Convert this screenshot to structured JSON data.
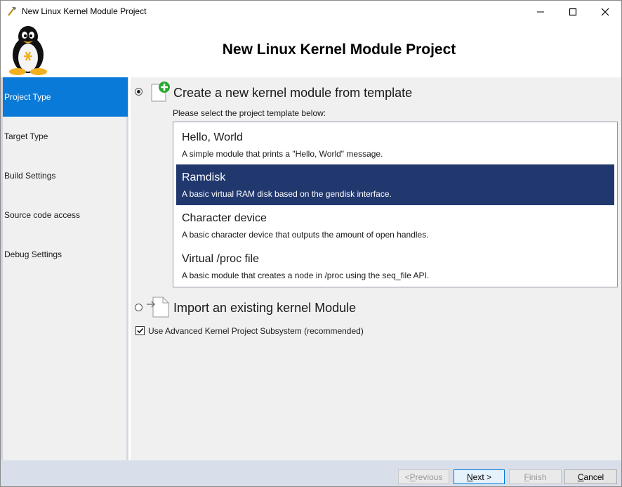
{
  "window": {
    "title": "New Linux Kernel Module Project",
    "controls": {
      "minimize_icon": "minimize-icon",
      "maximize_icon": "maximize-icon",
      "close_icon": "close-icon"
    }
  },
  "header": {
    "title": "New Linux Kernel Module Project",
    "logo_icon": "tux-penguin-icon"
  },
  "sidebar": {
    "items": [
      {
        "label": "Project Type",
        "active": true
      },
      {
        "label": "Target Type",
        "active": false
      },
      {
        "label": "Build Settings",
        "active": false
      },
      {
        "label": "Source code access",
        "active": false
      },
      {
        "label": "Debug Settings",
        "active": false
      }
    ]
  },
  "main": {
    "create_option": {
      "label": "Create a new kernel module from template",
      "selected": true,
      "icon": "new-document-icon"
    },
    "template_prompt": "Please select the project template below:",
    "templates": [
      {
        "title": "Hello, World",
        "desc": "A simple module that prints a \"Hello, World\" message.",
        "selected": false
      },
      {
        "title": "Ramdisk",
        "desc": "A basic virtual RAM disk based on the gendisk interface.",
        "selected": true
      },
      {
        "title": "Character device",
        "desc": "A basic character device that outputs the amount of open handles.",
        "selected": false
      },
      {
        "title": "Virtual /proc file",
        "desc": "A basic module that creates a node in /proc using the seq_file API.",
        "selected": false
      }
    ],
    "import_option": {
      "label": "Import an existing kernel Module",
      "selected": false,
      "icon": "import-document-icon"
    },
    "advanced_checkbox": {
      "label": "Use Advanced Kernel Project Subsystem (recommended)",
      "checked": true
    }
  },
  "footer": {
    "previous": {
      "prefix": "< ",
      "hotkey": "P",
      "rest": "revious"
    },
    "next": {
      "hotkey": "N",
      "rest": "ext >"
    },
    "finish": {
      "hotkey": "F",
      "rest": "inish"
    },
    "cancel": {
      "hotkey": "C",
      "rest": "ancel"
    }
  },
  "colors": {
    "accent": "#0a7ad8",
    "selection": "#21386f",
    "footer": "#d9dfea"
  }
}
